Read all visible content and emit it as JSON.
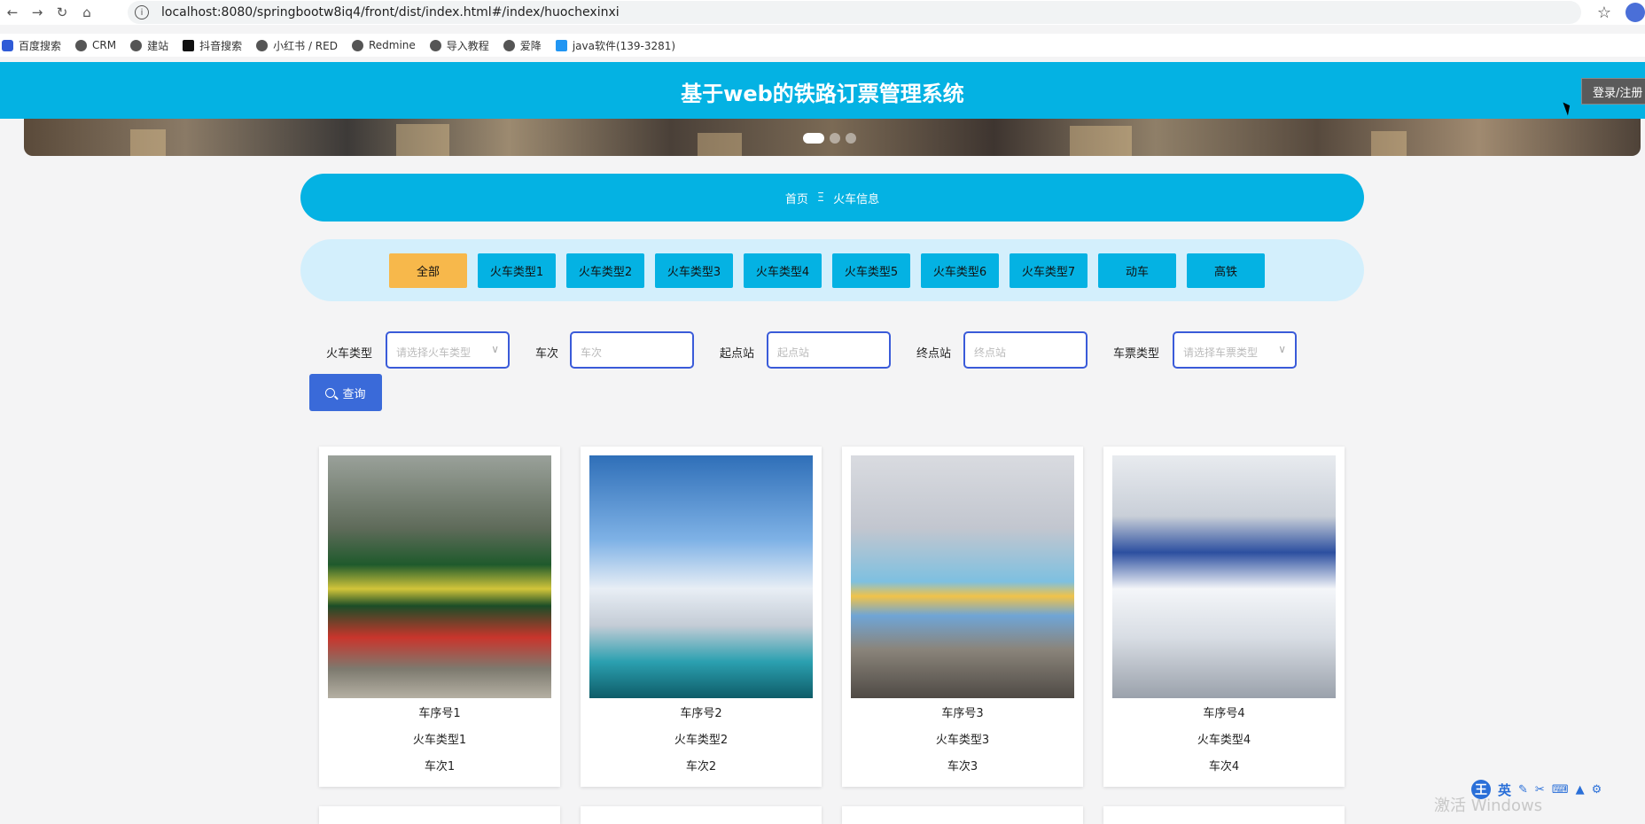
{
  "browser": {
    "url": "localhost:8080/springbootw8iq4/front/dist/index.html#/index/huochexinxi",
    "bookmarks": [
      "百度搜索",
      "CRM",
      "建站",
      "抖音搜索",
      "小红书 / RED",
      "Redmine",
      "导入教程",
      "爱降",
      "java软件(139-3281)"
    ]
  },
  "header": {
    "title": "基于web的铁路订票管理系统",
    "login_label": "登录/注册"
  },
  "breadcrumb": {
    "home": "首页",
    "separator": "Ξ",
    "current": "火车信息"
  },
  "categories": [
    "全部",
    "火车类型1",
    "火车类型2",
    "火车类型3",
    "火车类型4",
    "火车类型5",
    "火车类型6",
    "火车类型7",
    "动车",
    "高铁"
  ],
  "active_category": "全部",
  "search": {
    "train_type_label": "火车类型",
    "train_type_placeholder": "请选择火车类型",
    "train_no_label": "车次",
    "train_no_placeholder": "车次",
    "from_label": "起点站",
    "from_placeholder": "起点站",
    "to_label": "终点站",
    "to_placeholder": "终点站",
    "ticket_type_label": "车票类型",
    "ticket_type_placeholder": "请选择车票类型",
    "button_label": "查询"
  },
  "cards": [
    {
      "seq": "车序号1",
      "type": "火车类型1",
      "train_no": "车次1"
    },
    {
      "seq": "车序号2",
      "type": "火车类型2",
      "train_no": "车次2"
    },
    {
      "seq": "车序号3",
      "type": "火车类型3",
      "train_no": "车次3"
    },
    {
      "seq": "车序号4",
      "type": "火车类型4",
      "train_no": "车次4"
    }
  ],
  "watermark": "激活 Windows",
  "ime": {
    "wang": "王",
    "lang": "英"
  },
  "colors": {
    "primary": "#04b2e3",
    "active_tab": "#f7b84b",
    "button": "#3a6ad9",
    "tabs_bg": "#d3effc"
  }
}
